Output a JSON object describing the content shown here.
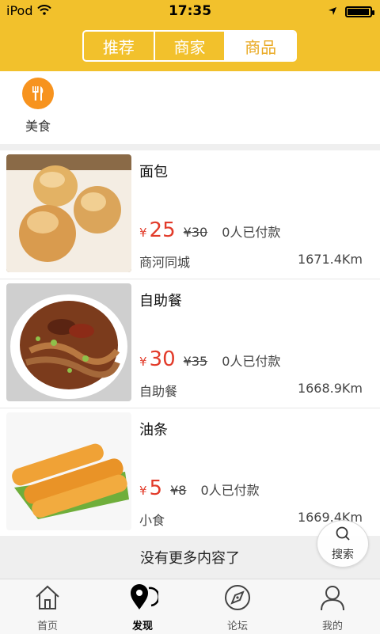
{
  "statusbar": {
    "carrier": "iPod",
    "time": "17:35",
    "battery_level": 0.95
  },
  "topbar": {
    "segments": [
      {
        "label": "推荐"
      },
      {
        "label": "商家"
      },
      {
        "label": "商品"
      }
    ],
    "active_segment": "商品"
  },
  "categories": [
    {
      "label": "美食",
      "icon": "fork-knife-icon"
    }
  ],
  "products": [
    {
      "name": "面包",
      "currency": "¥",
      "price": "25",
      "old_price": "¥30",
      "paid": "0人已付款",
      "category": "商河同城",
      "distance": "1671.4Km"
    },
    {
      "name": "自助餐",
      "currency": "¥",
      "price": "30",
      "old_price": "¥35",
      "paid": "0人已付款",
      "category": "自助餐",
      "distance": "1668.9Km"
    },
    {
      "name": "油条",
      "currency": "¥",
      "price": "5",
      "old_price": "¥8",
      "paid": "0人已付款",
      "category": "小食",
      "distance": "1669.4Km"
    }
  ],
  "footer_note": "没有更多内容了",
  "search_fab": {
    "label": "搜索"
  },
  "tabs": [
    {
      "label": "首页",
      "icon": "home-icon"
    },
    {
      "label": "发现",
      "icon": "location-pin-icon"
    },
    {
      "label": "论坛",
      "icon": "compass-icon"
    },
    {
      "label": "我的",
      "icon": "user-icon"
    }
  ],
  "active_tab": "发现"
}
